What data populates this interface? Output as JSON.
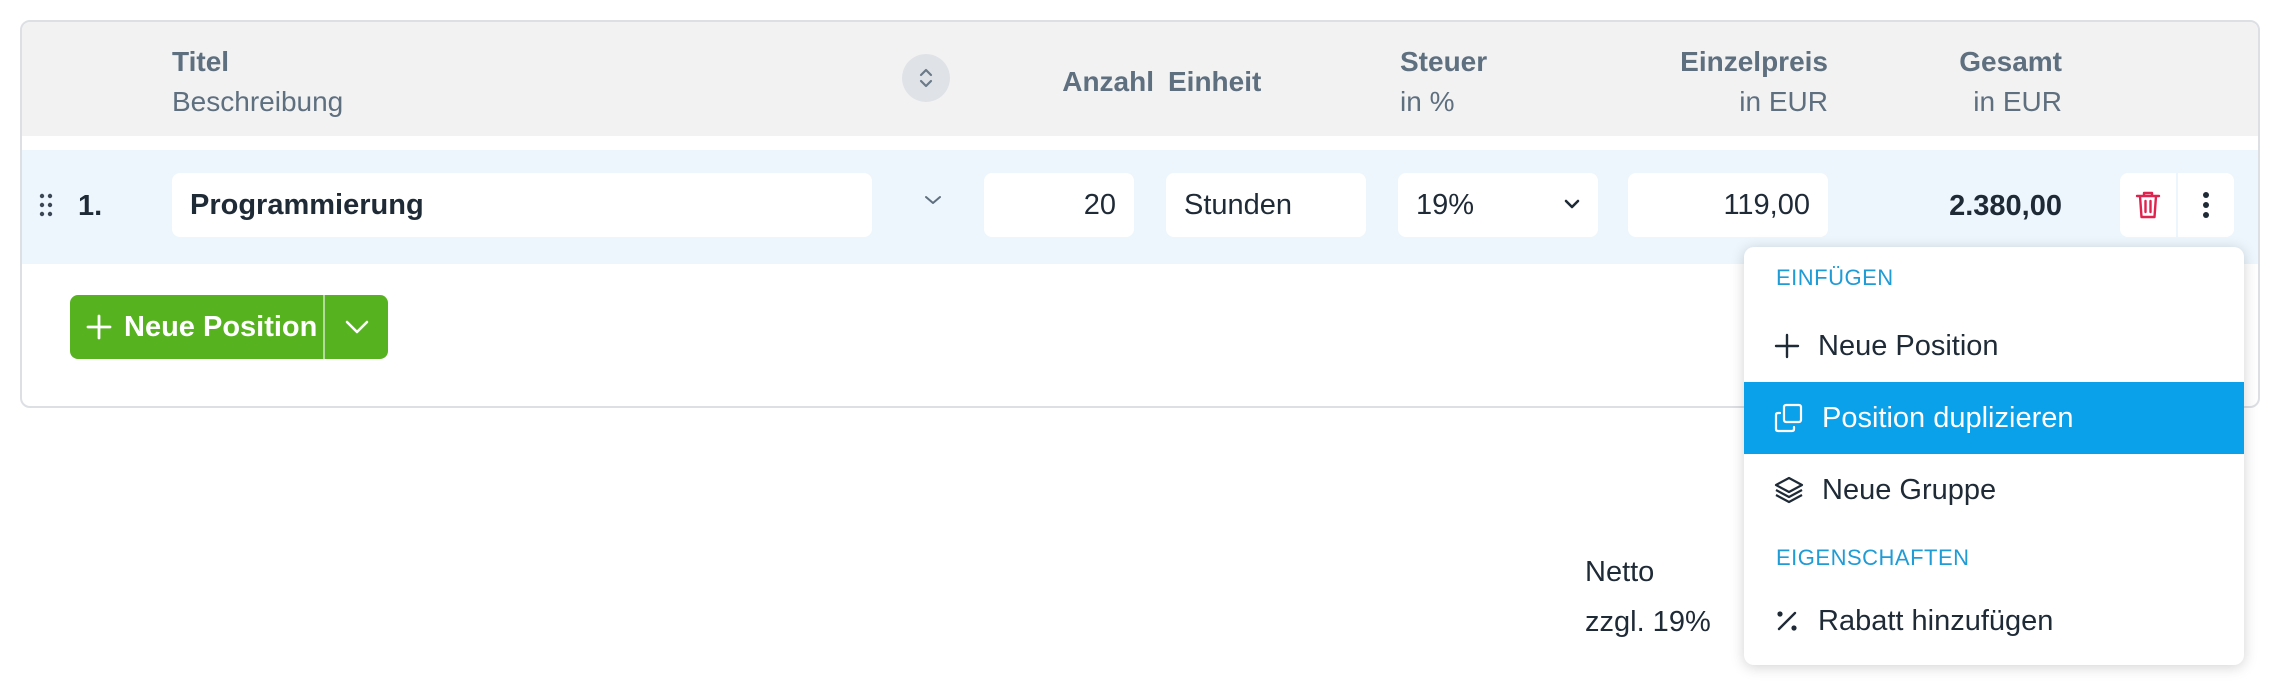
{
  "table": {
    "headers": {
      "title": "Titel",
      "description": "Beschreibung",
      "quantity": "Anzahl",
      "unit": "Einheit",
      "tax": "Steuer",
      "tax_unit": "in %",
      "unit_price": "Einzelpreis",
      "unit_price_currency": "in EUR",
      "total": "Gesamt",
      "total_currency": "in EUR"
    },
    "rows": [
      {
        "number": "1.",
        "title": "Programmierung",
        "quantity": "20",
        "unit": "Stunden",
        "tax": "19%",
        "unit_price": "119,00",
        "total": "2.380,00"
      }
    ]
  },
  "add_button": {
    "label": "Neue Position"
  },
  "summary": {
    "net_label": "Netto",
    "tax_label": "zzgl. 19%"
  },
  "context_menu": {
    "section_insert": "EINFÜGEN",
    "new_position": "Neue Position",
    "duplicate_position": "Position duplizieren",
    "new_group": "Neue Gruppe",
    "section_properties": "EIGENSCHAFTEN",
    "add_discount": "Rabatt hinzufügen"
  },
  "colors": {
    "header_bg": "#f2f2f2",
    "row_bg": "#edf6fd",
    "primary_green": "#56b21f",
    "menu_active": "#0aa0ea",
    "menu_section": "#1f9bd6",
    "delete_red": "#e0234e"
  },
  "icons": {
    "drag": "drag-handle-icon",
    "sort": "sort-icon",
    "delete": "trash-icon",
    "more": "more-vertical-icon",
    "plus": "plus-icon",
    "duplicate": "copy-icon",
    "group": "layers-icon",
    "discount": "percent-icon"
  }
}
